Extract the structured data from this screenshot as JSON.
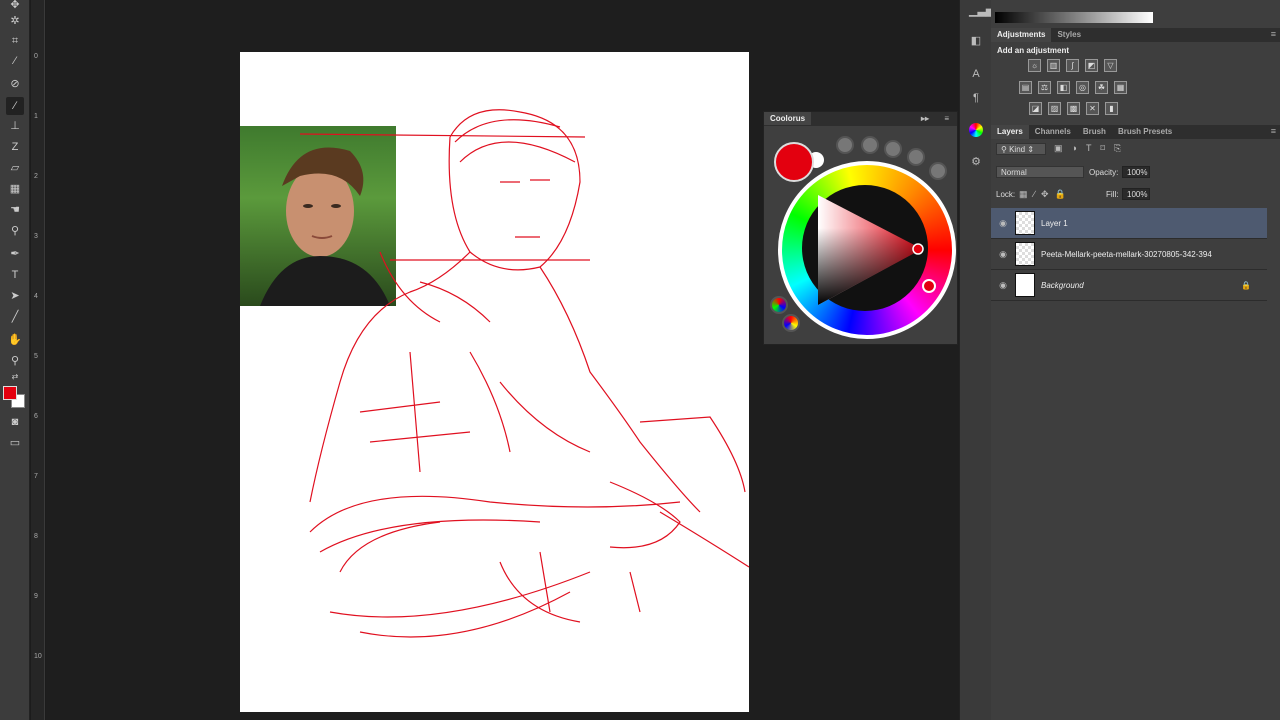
{
  "toolbar": {
    "tools": [
      "move-tool",
      "magic-wand-tool",
      "crop-tool",
      "eyedropper-tool",
      "healing-brush-tool",
      "brush-tool",
      "clone-stamp-tool",
      "history-brush-tool",
      "eraser-tool",
      "gradient-tool",
      "smudge-tool",
      "dodge-tool",
      "pen-tool",
      "type-tool",
      "path-selection-tool",
      "line-tool",
      "hand-tool",
      "zoom-tool"
    ],
    "active_tool": "brush-tool",
    "foreground_color": "#e3000f",
    "background_color": "#ffffff"
  },
  "ruler": {
    "labels": [
      "0",
      "1",
      "2",
      "3",
      "4",
      "5",
      "6",
      "7",
      "8",
      "9",
      "10"
    ]
  },
  "coolorus": {
    "title": "Coolorus",
    "selected_color": "#e3000f"
  },
  "adjustments": {
    "tabs": [
      "Adjustments",
      "Styles"
    ],
    "heading": "Add an adjustment"
  },
  "layers": {
    "tabs": [
      "Layers",
      "Channels",
      "Brush",
      "Brush Presets"
    ],
    "filter": "Kind",
    "blend_mode": "Normal",
    "opacity_label": "Opacity:",
    "opacity": "100%",
    "lock_label": "Lock:",
    "fill_label": "Fill:",
    "fill": "100%",
    "items": [
      {
        "name": "Layer 1",
        "selected": true
      },
      {
        "name": "Peeta-Mellark-peeta-mellark-30270805-342-394",
        "selected": false
      },
      {
        "name": "Background",
        "selected": false,
        "locked": true
      }
    ]
  }
}
